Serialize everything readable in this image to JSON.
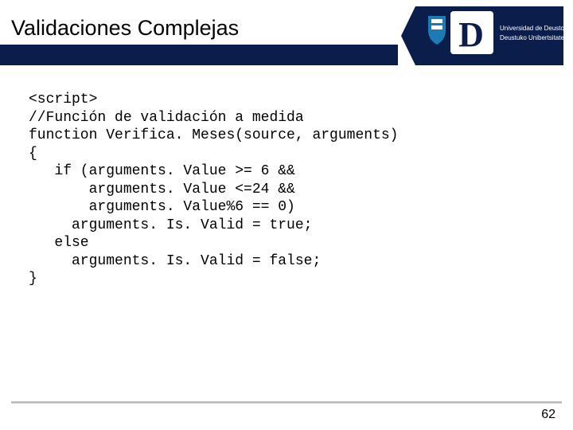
{
  "header": {
    "title": "Validaciones Complejas",
    "brand_top": "Universidad de Deusto",
    "brand_bottom": "Deustuko Unibertsitatea"
  },
  "code": {
    "lines": [
      "<script>",
      "//Función de validación a medida",
      "function Verifica. Meses(source, arguments)",
      "{",
      "   if (arguments. Value >= 6 &&",
      "       arguments. Value <=24 &&",
      "       arguments. Value%6 == 0)",
      "     arguments. Is. Valid = true;",
      "   else",
      "     arguments. Is. Valid = false;",
      "}"
    ]
  },
  "footer": {
    "page_number": "62"
  },
  "colors": {
    "navy": "#0b1d4a",
    "accent_blue": "#1c7bb5",
    "grey_rule": "#b9b9b9"
  }
}
